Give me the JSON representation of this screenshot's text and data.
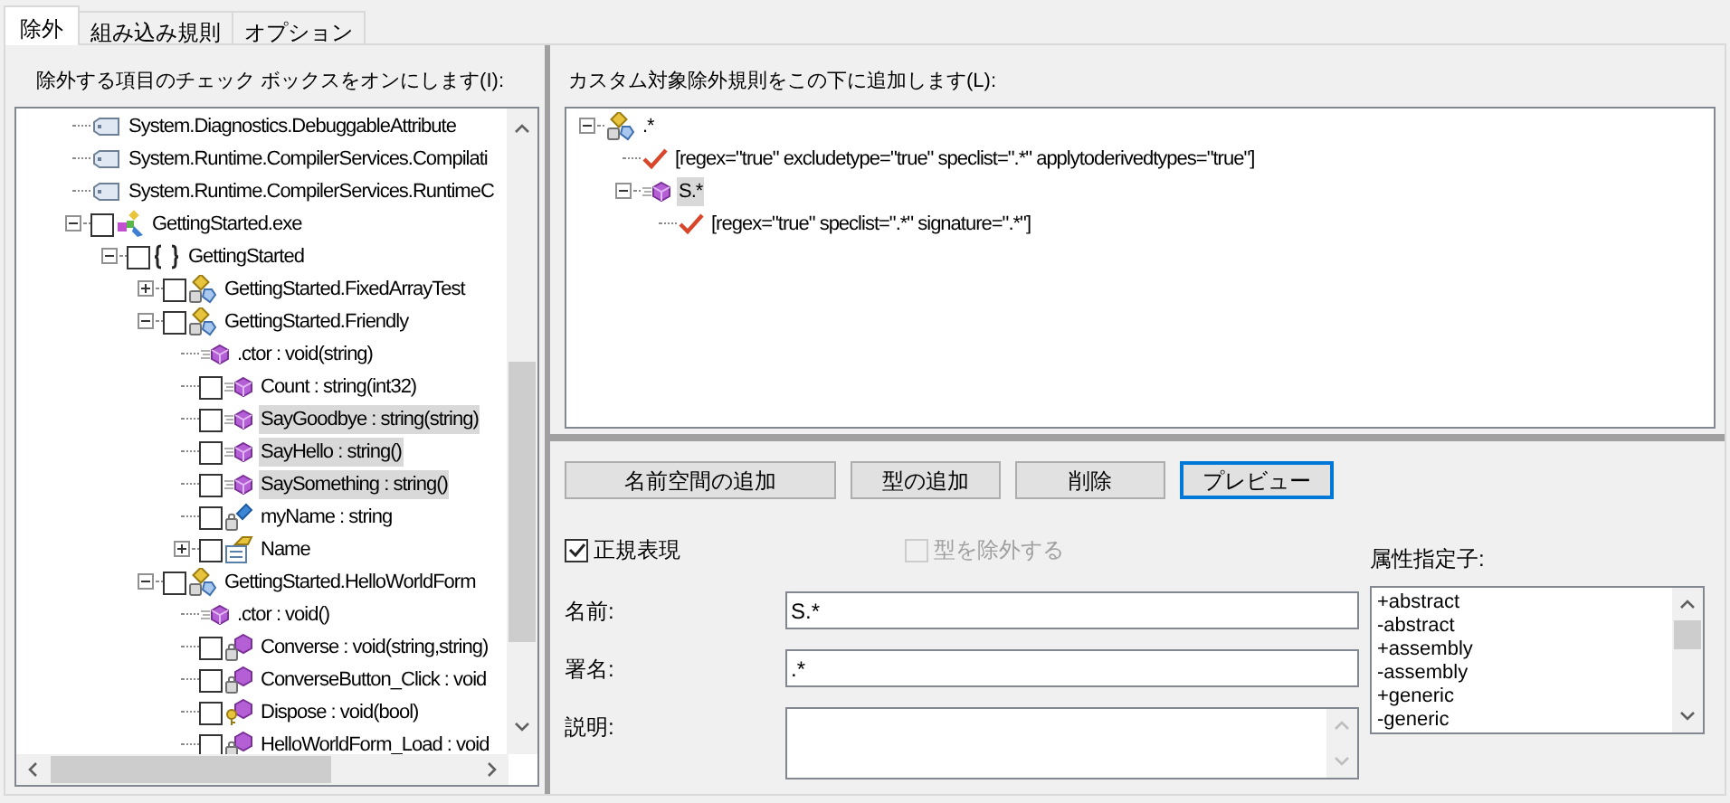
{
  "tabs": [
    {
      "label": "除外",
      "selected": true
    },
    {
      "label": "組み込み規則",
      "selected": false
    },
    {
      "label": "オプション",
      "selected": false
    }
  ],
  "exclude_panel": {
    "label": "除外する項目のチェック ボックスをオンにします(I):",
    "tree": [
      {
        "label": "System.Diagnostics.DebuggableAttribute",
        "kind": "attribute",
        "selected": false
      },
      {
        "label": "System.Runtime.CompilerServices.Compilati",
        "kind": "attribute",
        "selected": false
      },
      {
        "label": "System.Runtime.CompilerServices.RuntimeC",
        "kind": "attribute",
        "selected": false
      },
      {
        "label": "GettingStarted.exe",
        "kind": "assembly",
        "checked": false,
        "expanded": true,
        "selected": false,
        "children": [
          {
            "label": "GettingStarted",
            "kind": "namespace",
            "checked": false,
            "expanded": true,
            "selected": false,
            "children": [
              {
                "label": "GettingStarted.FixedArrayTest",
                "kind": "class",
                "checked": false,
                "expanded": false,
                "selected": false
              },
              {
                "label": "GettingStarted.Friendly",
                "kind": "class",
                "checked": false,
                "expanded": true,
                "selected": false,
                "children": [
                  {
                    "label": ".ctor : void(string)",
                    "kind": "method",
                    "selected": false
                  },
                  {
                    "label": "Count : string(int32)",
                    "kind": "method",
                    "checked": false,
                    "selected": false
                  },
                  {
                    "label": "SayGoodbye : string(string)",
                    "kind": "method",
                    "checked": false,
                    "selected": true
                  },
                  {
                    "label": "SayHello : string()",
                    "kind": "method",
                    "checked": false,
                    "selected": true
                  },
                  {
                    "label": "SaySomething : string()",
                    "kind": "method",
                    "checked": false,
                    "selected": true
                  },
                  {
                    "label": "myName : string",
                    "kind": "field",
                    "checked": false,
                    "selected": false
                  },
                  {
                    "label": "Name",
                    "kind": "property",
                    "checked": false,
                    "expanded": false,
                    "selected": false
                  }
                ]
              },
              {
                "label": "GettingStarted.HelloWorldForm",
                "kind": "class",
                "checked": false,
                "expanded": true,
                "selected": false,
                "children": [
                  {
                    "label": ".ctor : void()",
                    "kind": "method",
                    "selected": false
                  },
                  {
                    "label": "Converse : void(string,string)",
                    "kind": "private-method",
                    "checked": false,
                    "selected": false
                  },
                  {
                    "label": "ConverseButton_Click : void",
                    "kind": "private-method",
                    "checked": false,
                    "selected": false
                  },
                  {
                    "label": "Dispose : void(bool)",
                    "kind": "protected-method",
                    "checked": false,
                    "selected": false
                  },
                  {
                    "label": "HelloWorldForm_Load : void",
                    "kind": "private-method",
                    "checked": false,
                    "selected": false
                  }
                ]
              }
            ]
          }
        ]
      }
    ]
  },
  "rules_panel": {
    "label": "カスタム対象除外規則をこの下に追加します(L):",
    "tree": [
      {
        "label": ".*",
        "kind": "class",
        "expanded": true,
        "selected": false,
        "children": [
          {
            "label": "[regex=\"true\" excludetype=\"true\" speclist=\".*\" applytoderivedtypes=\"true\"]",
            "kind": "rule",
            "selected": false
          },
          {
            "label": "S.*",
            "kind": "method",
            "expanded": true,
            "selected": true,
            "children": [
              {
                "label": "[regex=\"true\" speclist=\".*\" signature=\".*\"]",
                "kind": "rule",
                "selected": false
              }
            ]
          }
        ]
      }
    ]
  },
  "buttons": [
    {
      "label": "名前空間の追加",
      "focused": false
    },
    {
      "label": "型の追加",
      "focused": false
    },
    {
      "label": "削除",
      "focused": false
    },
    {
      "label": "プレビュー",
      "focused": true
    }
  ],
  "regex_checkbox": {
    "label": "正規表現",
    "checked": true
  },
  "exclude_type_checkbox": {
    "label": "型を除外する",
    "checked": false,
    "disabled": true
  },
  "fields": [
    {
      "label": "名前:",
      "value": "S.*",
      "kind": "line"
    },
    {
      "label": "署名:",
      "value": ".*",
      "kind": "line"
    },
    {
      "label": "説明:",
      "kind": "multiline"
    }
  ],
  "attributes": {
    "label": "属性指定子:",
    "items": [
      "+abstract",
      "-abstract",
      "+assembly",
      "-assembly",
      "+generic",
      "-generic"
    ]
  }
}
